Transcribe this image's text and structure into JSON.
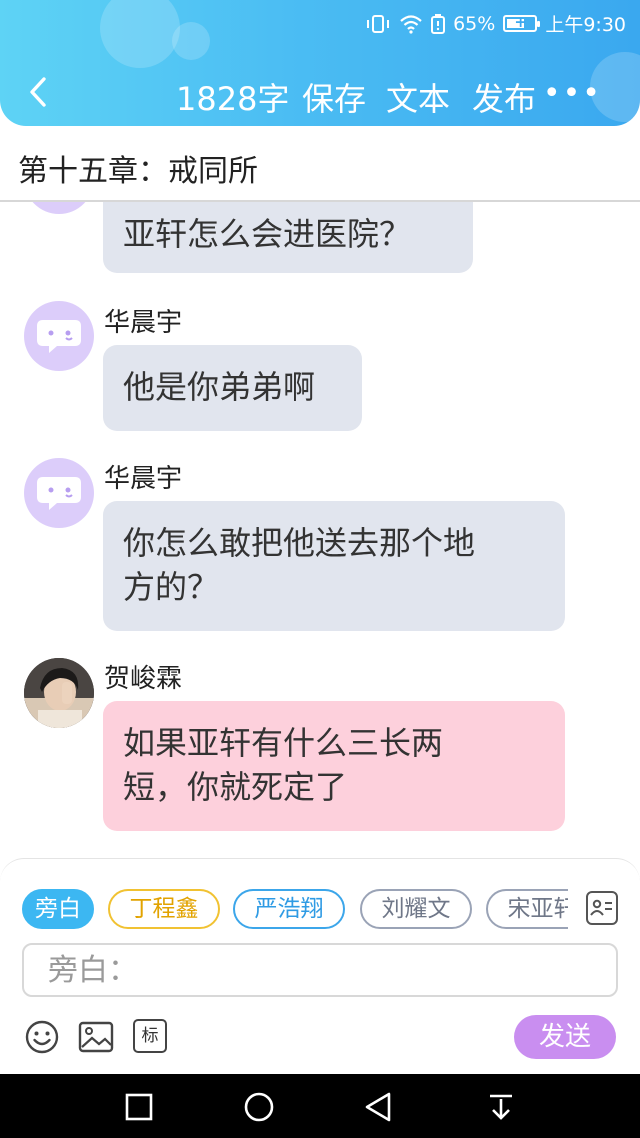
{
  "status_bar": {
    "battery_percent": "65%",
    "time": "上午9:30",
    "battery_level": 0.65,
    "icons": [
      "vibrate-icon",
      "wifi-icon",
      "battery-saver-icon",
      "battery-charging-icon"
    ]
  },
  "header": {
    "word_count": "1828字",
    "save_label": "保存",
    "text_label": "文本",
    "publish_label": "发布",
    "more_label": "•••",
    "back_icon": "chevron-left-icon"
  },
  "chapter": {
    "title": "第十五章：戒同所"
  },
  "messages": [
    {
      "sender": "",
      "text": "亚轩怎么会进医院？",
      "avatar": "chat-bubble-icon",
      "bubble_color": "#e1e5ee"
    },
    {
      "sender": "华晨宇",
      "text": "他是你弟弟啊",
      "avatar": "chat-bubble-icon",
      "bubble_color": "#e1e5ee"
    },
    {
      "sender": "华晨宇",
      "text": "你怎么敢把他送去那个地方的？",
      "line1": "你怎么敢把他送去那个地",
      "line2": "方的？",
      "avatar": "chat-bubble-icon",
      "bubble_color": "#e1e5ee"
    },
    {
      "sender": "贺峻霖",
      "text": "如果亚轩有什么三长两短，你就死定了",
      "line1": "如果亚轩有什么三长两",
      "line2": "短，你就死定了",
      "avatar": "user-photo",
      "bubble_color": "#fdd0dc"
    }
  ],
  "role_chips": [
    {
      "label": "旁白",
      "selected": true,
      "color": "#3cb7f2"
    },
    {
      "label": "丁程鑫",
      "selected": false,
      "color": "#f1c232"
    },
    {
      "label": "严浩翔",
      "selected": false,
      "color": "#3ca6ea"
    },
    {
      "label": "刘耀文",
      "selected": false,
      "color": "#9aa3b6"
    },
    {
      "label": "宋亚轩",
      "selected": false,
      "color": "#9aa3b6"
    }
  ],
  "input": {
    "placeholder": "旁白：",
    "value": ""
  },
  "toolbar": {
    "emoji_icon": "emoji-icon",
    "image_icon": "image-icon",
    "tag_label": "标",
    "send_label": "发送",
    "contacts_icon": "contacts-icon"
  },
  "colors": {
    "header_start": "#5ed3f5",
    "header_end": "#3aa8ef",
    "avatar_purple": "#dccdfa",
    "send_button": "#c98ef0"
  }
}
